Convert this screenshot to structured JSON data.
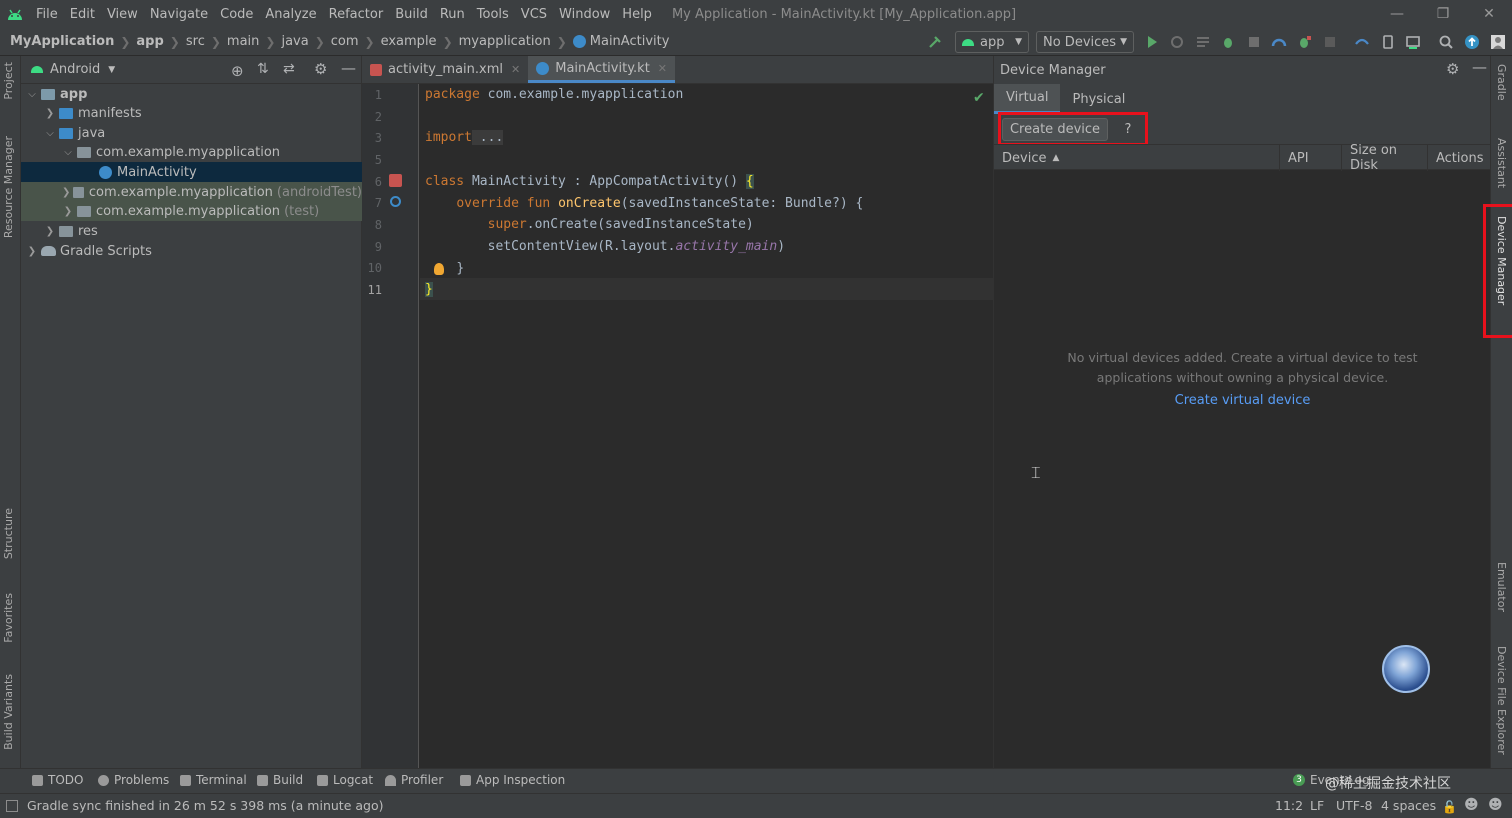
{
  "menubar": {
    "items": [
      "File",
      "Edit",
      "View",
      "Navigate",
      "Code",
      "Analyze",
      "Refactor",
      "Build",
      "Run",
      "Tools",
      "VCS",
      "Window",
      "Help"
    ],
    "title": "My Application - MainActivity.kt [My_Application.app]"
  },
  "navbar": {
    "breadcrumbs": [
      "MyApplication",
      "app",
      "src",
      "main",
      "java",
      "com",
      "example",
      "myapplication",
      "MainActivity"
    ],
    "run_config": "app",
    "device_combo": "No Devices"
  },
  "project": {
    "view_label": "Android",
    "tree": [
      {
        "label": "app",
        "suffix": ""
      },
      {
        "label": "manifests",
        "suffix": ""
      },
      {
        "label": "java",
        "suffix": ""
      },
      {
        "label": "com.example.myapplication",
        "suffix": ""
      },
      {
        "label": "MainActivity",
        "suffix": ""
      },
      {
        "label": "com.example.myapplication",
        "suffix": "(androidTest)"
      },
      {
        "label": "com.example.myapplication",
        "suffix": "(test)"
      },
      {
        "label": "res",
        "suffix": ""
      },
      {
        "label": "Gradle Scripts",
        "suffix": ""
      }
    ]
  },
  "left_strip": [
    "Project",
    "Resource Manager",
    "Structure",
    "Favorites",
    "Build Variants"
  ],
  "right_strip": [
    "Gradle",
    "Assistant",
    "Device Manager",
    "Emulator",
    "Device File Explorer"
  ],
  "editor": {
    "tabs": [
      "activity_main.xml",
      "MainActivity.kt"
    ],
    "line_numbers": [
      "1",
      "2",
      "3",
      "5",
      "6",
      "7",
      "8",
      "9",
      "10",
      "11"
    ],
    "code": {
      "l1_kw": "package",
      "l1_rest": " com.example.myapplication",
      "l3_kw": "import",
      "l3_rest": " ...",
      "l6_kw": "class",
      "l6_rest": " MainActivity : AppCompatActivity() ",
      "l6_brace": "{",
      "l7_kw": "override fun ",
      "l7_fn": "onCreate",
      "l7_rest": "(savedInstanceState: Bundle?) {",
      "l8_kw": "super",
      "l8_rest": ".onCreate(savedInstanceState)",
      "l9_a": "setContentView(R.layout.",
      "l9_it": "activity_main",
      "l9_b": ")",
      "l10": "}",
      "l11": "}"
    }
  },
  "device_manager": {
    "title": "Device Manager",
    "tabs": [
      "Virtual",
      "Physical"
    ],
    "create_button": "Create device",
    "help_button": "?",
    "columns": [
      "Device",
      "API",
      "Size on Disk",
      "Actions"
    ],
    "empty_line1": "No virtual devices added. Create a virtual device to test",
    "empty_line2": "applications without owning a physical device.",
    "create_link": "Create virtual device",
    "highlight_color": "#e8111c"
  },
  "bottom_tabs": [
    "TODO",
    "Problems",
    "Terminal",
    "Build",
    "Logcat",
    "Profiler",
    "App Inspection"
  ],
  "status": {
    "message": "Gradle sync finished in 26 m 52 s 398 ms (a minute ago)",
    "event_count": "3",
    "event_label": "Event Log",
    "watermark": "@稀土掘金技术社区",
    "position": "11:2",
    "line_sep": "LF",
    "encoding": "UTF-8",
    "indent": "4 spaces"
  }
}
